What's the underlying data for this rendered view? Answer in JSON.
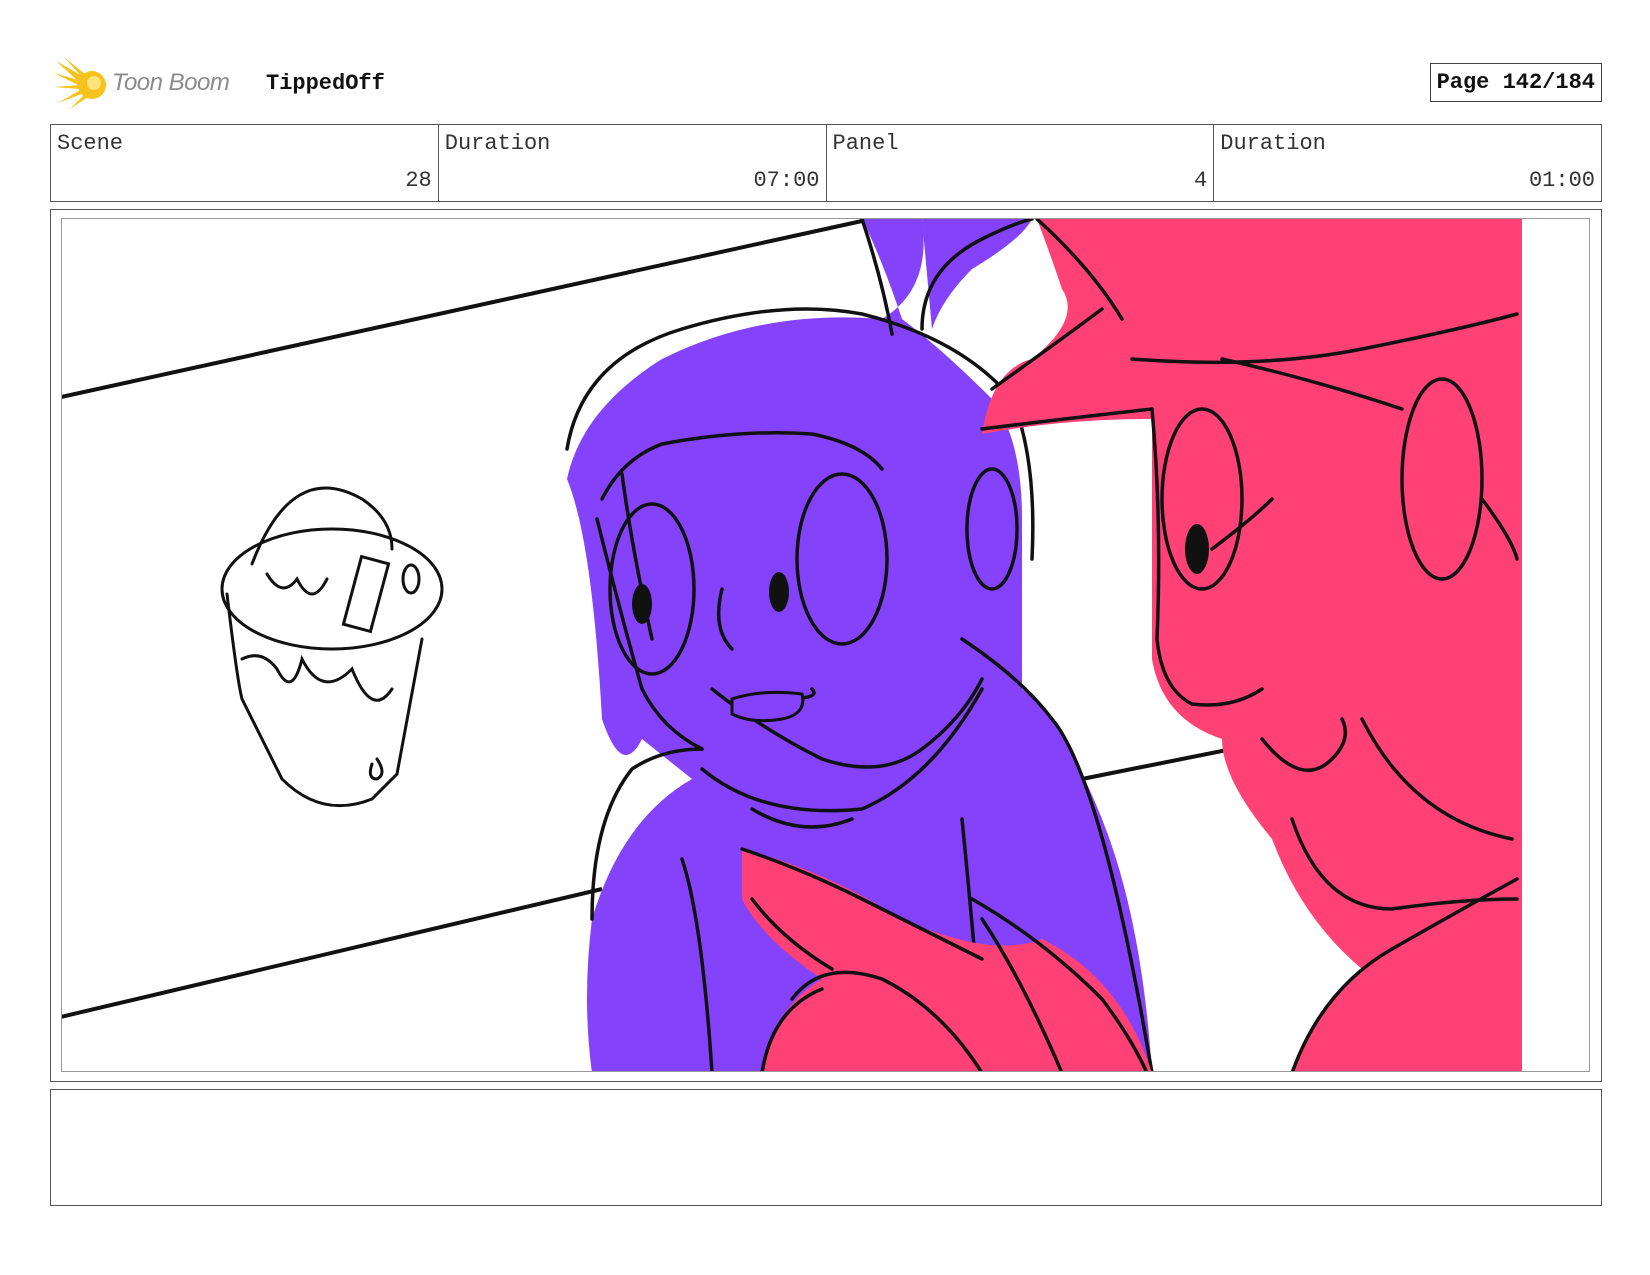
{
  "header": {
    "logo_text": "Toon Boom",
    "project_title": "TippedOff",
    "page_indicator": "Page 142/184"
  },
  "info": {
    "scene_label": "Scene",
    "scene_value": "28",
    "scene_duration_label": "Duration",
    "scene_duration_value": "07:00",
    "panel_label": "Panel",
    "panel_value": "4",
    "panel_duration_label": "Duration",
    "panel_duration_value": "01:00"
  },
  "colors": {
    "character_left": "#8442fb",
    "character_right": "#ff4176",
    "logo_accent": "#f6c21c"
  },
  "icons": {
    "logo": "toon-boom-burst-icon"
  },
  "notes": {
    "text": ""
  }
}
